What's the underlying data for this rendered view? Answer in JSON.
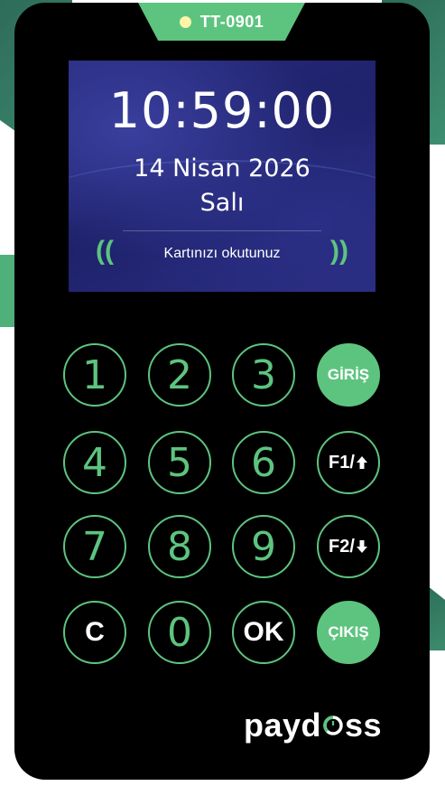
{
  "device": {
    "id_label": "TT-0901",
    "brand": {
      "prefix": "payd",
      "suffix": "ss"
    }
  },
  "screen": {
    "time": "10:59:00",
    "date": "14 Nisan 2026",
    "day": "Salı",
    "prompt": "Kartınızı okutunuz"
  },
  "keypad": {
    "k1": "1",
    "k2": "2",
    "k3": "3",
    "k4": "4",
    "k5": "5",
    "k6": "6",
    "k7": "7",
    "k8": "8",
    "k9": "9",
    "clear": "C",
    "k0": "0",
    "ok": "OK",
    "checkin": "GİRİŞ",
    "f1": "F1/",
    "f2": "F2/",
    "checkout": "ÇIKIŞ"
  },
  "colors": {
    "accent": "#5dc47f",
    "screen_bg": "#23267a",
    "device_bg": "#000000",
    "status_dot": "#fff4a8"
  },
  "icons": {
    "status": "status-dot-icon",
    "nfc_left": "nfc-wave-left-icon",
    "nfc_right": "nfc-wave-right-icon",
    "up": "arrow-up-icon",
    "down": "arrow-down-icon",
    "logo": "paydoss-logo-icon"
  }
}
